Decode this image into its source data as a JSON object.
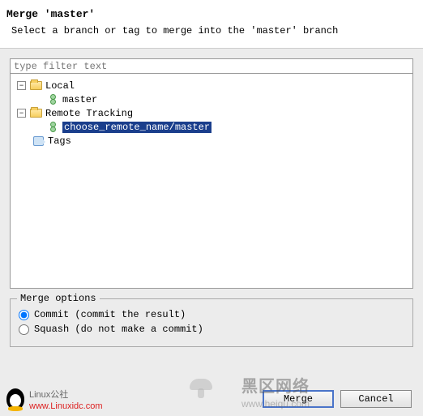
{
  "header": {
    "title": "Merge 'master'",
    "subtitle": "Select a branch or tag to merge into the 'master' branch"
  },
  "filter": {
    "placeholder": "type filter text"
  },
  "tree": {
    "local": {
      "label": "Local",
      "children": [
        {
          "label": "master"
        }
      ]
    },
    "remote": {
      "label": "Remote Tracking",
      "children": [
        {
          "label": "choose_remote_name/master",
          "selected": true
        }
      ]
    },
    "tags": {
      "label": "Tags"
    }
  },
  "options": {
    "legend": "Merge options",
    "commit": "Commit (commit the result)",
    "squash": "Squash (do not make a commit)"
  },
  "buttons": {
    "merge": "Merge",
    "cancel": "Cancel"
  },
  "watermarks": {
    "left_title": "Linux",
    "left_sub": "公社",
    "left_url": "www.Linuxidc.com",
    "right_title": "黑区网络",
    "right_url": "www.heiqu.com"
  }
}
